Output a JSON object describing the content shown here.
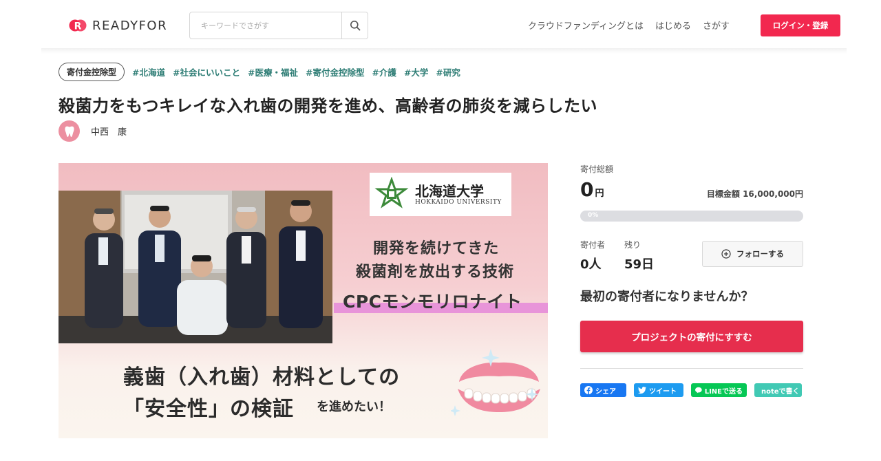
{
  "header": {
    "logo_text": "READYFOR",
    "search_placeholder": "キーワードでさがす",
    "nav": [
      "クラウドファンディングとは",
      "はじめる",
      "さがす"
    ],
    "login_label": "ログイン・登録"
  },
  "project": {
    "category_pill": "寄付金控除型",
    "hashtags": [
      "#北海道",
      "#社会にいいこと",
      "#医療・福祉",
      "#寄付金控除型",
      "#介護",
      "#大学",
      "#研究"
    ],
    "title": "殺菌力をもつキレイな入れ歯の開発を進め、高齢者の肺炎を減らしたい",
    "owner_name": "中西　康"
  },
  "hero": {
    "university_jp": "北海道大学",
    "university_en": "HOKKAIDO UNIVERSITY",
    "line1": "開発を続けてきた",
    "line2": "殺菌剤を放出する技術",
    "line3": "CPCモンモリロナイト",
    "line4": "義歯（入れ歯）材料としての",
    "line5_main": "「安全性」の検証",
    "line5_sub": "を進めたい！"
  },
  "funding": {
    "total_label": "寄付総額",
    "total_value": "0",
    "total_unit": "円",
    "goal_text": "目標金額 16,000,000円",
    "progress_text": "0%",
    "progress_fraction": 0,
    "supporters_label": "寄付者",
    "supporters_value": "0人",
    "remaining_label": "残り",
    "remaining_value": "59日",
    "follow_label": "フォローする",
    "first_supporter_text": "最初の寄付者になりませんか？",
    "cta_label": "プロジェクトの寄付にすすむ"
  },
  "share": {
    "facebook": "シェア",
    "twitter": "ツイート",
    "line": "LINEで送る",
    "note": "noteで書く"
  },
  "colors": {
    "brand_red": "#f2284f",
    "cta_red": "#e62e4d",
    "hashtag_teal": "#2e7d75",
    "facebook": "#1877f2",
    "twitter": "#1d9bf0",
    "line": "#06c755",
    "note": "#41c9b4"
  }
}
